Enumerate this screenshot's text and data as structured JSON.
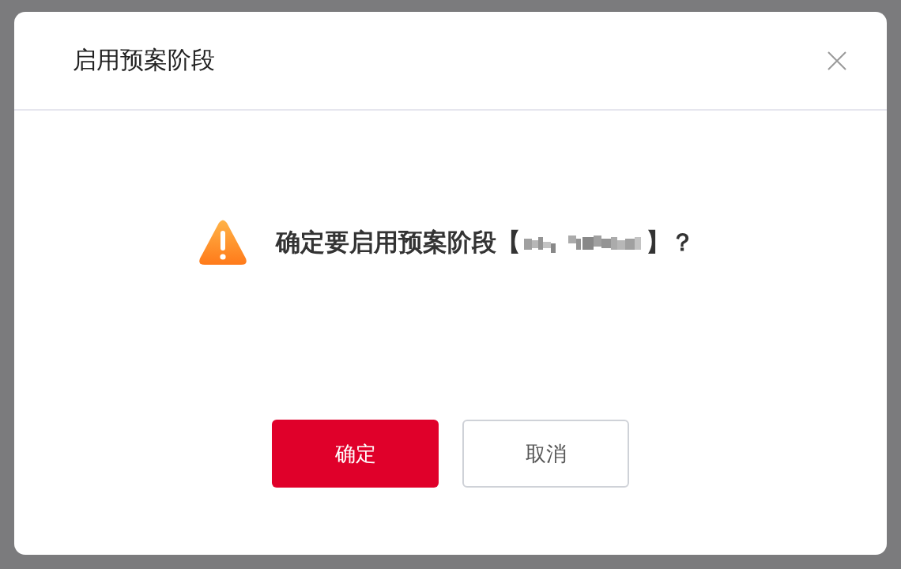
{
  "dialog": {
    "title": "启用预案阶段",
    "message": {
      "prefix": "确定要启用预案阶段【",
      "redacted": true,
      "suffix": "】？"
    },
    "buttons": [
      {
        "label": "确定",
        "kind": "primary"
      },
      {
        "label": "取消",
        "kind": "default"
      }
    ]
  }
}
